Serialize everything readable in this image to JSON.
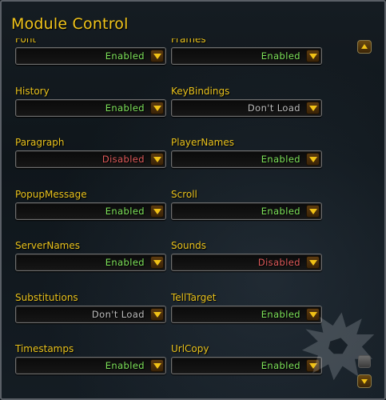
{
  "window": {
    "title": "Module Control"
  },
  "colors": {
    "title": "#f1c41a",
    "label": "#e9c21c",
    "enabled": "#7ee45a",
    "disabled": "#e05a5a",
    "dont_load": "#bdbdbd"
  },
  "modules": [
    {
      "name": "Font",
      "value": "Enabled",
      "status": "enabled"
    },
    {
      "name": "Frames",
      "value": "Enabled",
      "status": "enabled"
    },
    {
      "name": "History",
      "value": "Enabled",
      "status": "enabled"
    },
    {
      "name": "KeyBindings",
      "value": "Don't Load",
      "status": "dont_load"
    },
    {
      "name": "Paragraph",
      "value": "Disabled",
      "status": "disabled"
    },
    {
      "name": "PlayerNames",
      "value": "Enabled",
      "status": "enabled"
    },
    {
      "name": "PopupMessage",
      "value": "Enabled",
      "status": "enabled"
    },
    {
      "name": "Scroll",
      "value": "Enabled",
      "status": "enabled"
    },
    {
      "name": "ServerNames",
      "value": "Enabled",
      "status": "enabled"
    },
    {
      "name": "Sounds",
      "value": "Disabled",
      "status": "disabled"
    },
    {
      "name": "Substitutions",
      "value": "Don't Load",
      "status": "dont_load"
    },
    {
      "name": "TellTarget",
      "value": "Enabled",
      "status": "enabled"
    },
    {
      "name": "Timestamps",
      "value": "Enabled",
      "status": "enabled"
    },
    {
      "name": "UrlCopy",
      "value": "Enabled",
      "status": "enabled"
    }
  ],
  "icons": {
    "dropdown": "chevron-down-icon",
    "scroll_up": "arrow-up-icon",
    "scroll_down": "arrow-down-icon",
    "logo": "lion-head-logo"
  }
}
